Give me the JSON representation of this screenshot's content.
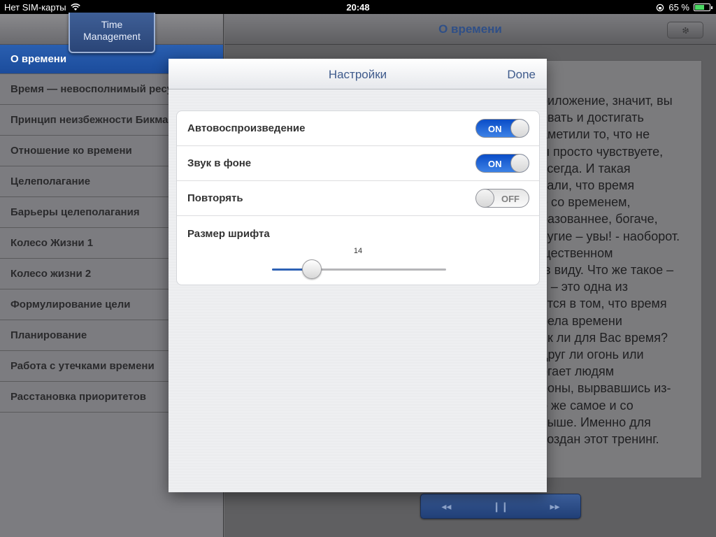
{
  "status_bar": {
    "carrier": "Нет SIM-карты",
    "time": "20:48",
    "battery_percent": "65 %",
    "battery_level": 0.65,
    "icons": [
      "wifi-icon",
      "lock-rotation-icon",
      "battery-icon"
    ]
  },
  "sidebar": {
    "logo_line1": "Time",
    "logo_line2": "Management",
    "items": [
      {
        "label": "О времени",
        "selected": true
      },
      {
        "label": "Время — невосполнимый ресурс"
      },
      {
        "label": "Принцип неизбежности Бикмана"
      },
      {
        "label": "Отношение ко времени"
      },
      {
        "label": "Целеполагание"
      },
      {
        "label": "Барьеры целеполагания"
      },
      {
        "label": "Колесо Жизни 1"
      },
      {
        "label": "Колесо жизни 2"
      },
      {
        "label": "Формулирование цели"
      },
      {
        "label": "Планирование"
      },
      {
        "label": "Работа с утечками времени"
      },
      {
        "label": "Расстановка приоритетов"
      }
    ]
  },
  "detail": {
    "title": "О времени",
    "gear_icon": "gear-icon",
    "text_lines": [
      "риложение, значит, вы",
      "евать и достигать",
      "аметили то, что не",
      "ы просто чувствуете,",
      "всегда. И такая",
      "чали, что время",
      "е со временем,",
      "разованнее, богаче,",
      "ругие – увы! - наоборот.",
      "щественном",
      " в виду. Что же такое –",
      "я – это одна из",
      "ятся в том, что время",
      "рела времени",
      "ик ли для Вас время?",
      "друг ли огонь или",
      "огает людям",
      "роны, вырвавшись из-",
      "о же самое и со",
      "выше. Именно для",
      "создан этот тренинг."
    ],
    "player": {
      "rewind": "◂◂",
      "pause": "❙❙",
      "forward": "▸▸"
    }
  },
  "settings": {
    "title": "Настройки",
    "done_label": "Done",
    "rows": [
      {
        "label": "Автовоспроизведение",
        "state": "ON",
        "on": true
      },
      {
        "label": "Звук в фоне",
        "state": "ON",
        "on": true
      },
      {
        "label": "Повторять",
        "state": "OFF",
        "on": false
      }
    ],
    "font_size": {
      "label": "Размер шрифта",
      "value": "14",
      "fraction": 0.23
    }
  }
}
